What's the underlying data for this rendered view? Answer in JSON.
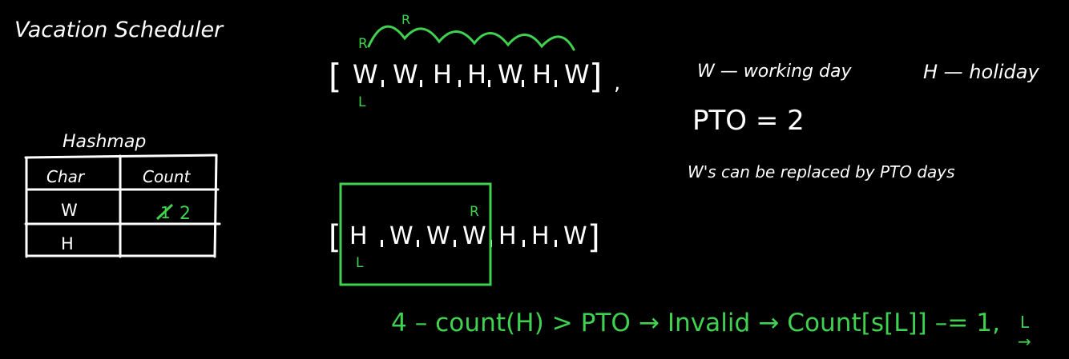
{
  "title": "Vacation Scheduler",
  "hashmap": {
    "label": "Hashmap",
    "headers": [
      "Char",
      "Count"
    ],
    "rows": [
      {
        "char": "W",
        "count": "2",
        "count_struck": "1"
      },
      {
        "char": "H",
        "count": ""
      }
    ]
  },
  "array_top": {
    "open": "[",
    "close": "]",
    "items": [
      "W",
      "W",
      "H",
      "H",
      "W",
      "H",
      "W"
    ],
    "trailing": ",",
    "pointer_L": "L",
    "pointer_R": "R",
    "arc_label": "R"
  },
  "array_bottom": {
    "open": "[",
    "close": "]",
    "items": [
      "H",
      "W",
      "W",
      "W",
      "H",
      "H",
      "W"
    ],
    "pointer_L": "L",
    "pointer_R": "R"
  },
  "legend": {
    "working": "W — working day",
    "holiday": "H — holiday",
    "pto": "PTO = 2",
    "note": "W's can be replaced by PTO days"
  },
  "formula": {
    "text": "4 – count(H) > PTO → Invalid → Count[s[L]] –= 1,",
    "move": "L",
    "move_arrow": "→"
  },
  "colors": {
    "background": "#000000",
    "chalk": "#ffffff",
    "marker": "#3fd14f"
  }
}
